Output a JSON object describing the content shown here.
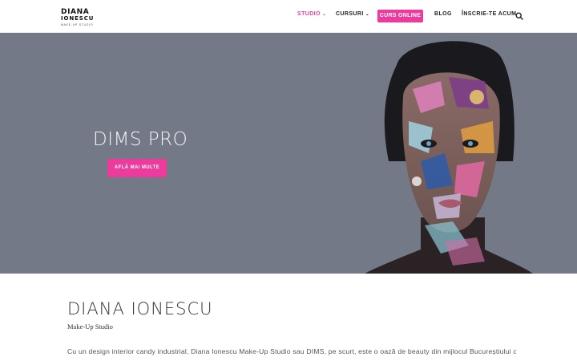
{
  "header": {
    "logo": {
      "line1": "DIANA",
      "line2": "IONESCU",
      "tagline": "MAKE-UP STUDIO"
    },
    "nav": [
      {
        "label": "STUDIO",
        "has_dropdown": true,
        "active": true
      },
      {
        "label": "CURSURI",
        "has_dropdown": true,
        "active": false
      },
      {
        "label": "CURS ONLINE",
        "highlight": true
      },
      {
        "label": "BLOG",
        "has_dropdown": false
      },
      {
        "label": "ÎNSCRIE-TE ACUM",
        "has_dropdown": false
      }
    ],
    "search_icon": "search-icon"
  },
  "hero": {
    "title": "DIMS PRO",
    "button_label": "AFLĂ MAI MULTE",
    "background_color": "#737987",
    "accent_color": "#ec3a9d"
  },
  "intro": {
    "title": "DIANA IONESCU",
    "subtitle": "Make-Up Studio",
    "body": "Cu un design interior candy industrial, Diana Ionescu Make-Up Studio sau DIMS, pe scurt, este o oază de beauty din mijlocul Bucureștiului ce"
  }
}
